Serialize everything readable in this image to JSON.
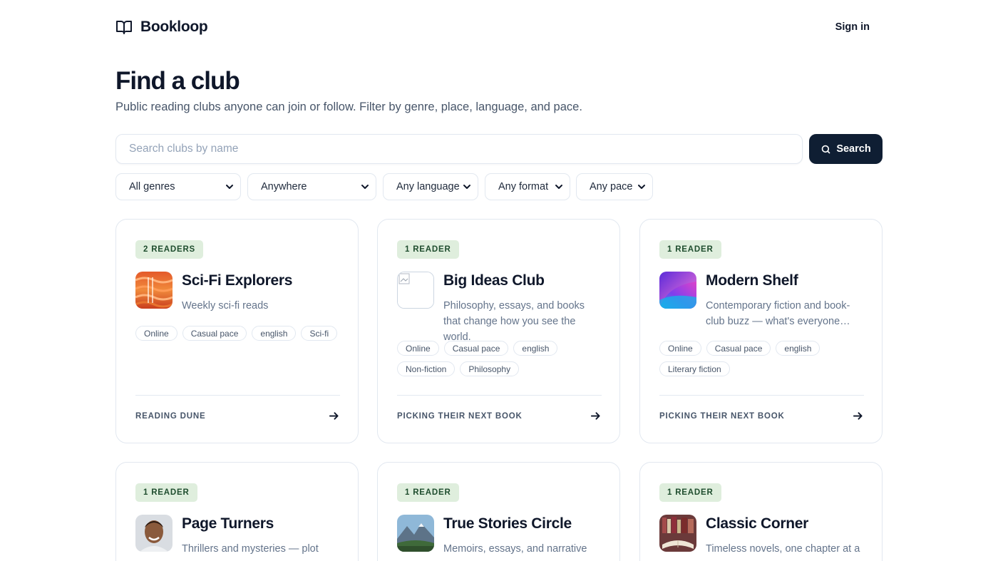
{
  "brand": {
    "name": "Bookloop",
    "icon": "open-book-icon"
  },
  "nav": {
    "sign_in": "Sign in"
  },
  "page": {
    "title": "Find a club",
    "subtitle": "Public reading clubs anyone can join or follow. Filter by genre, place, language, and pace."
  },
  "search": {
    "placeholder": "Search clubs by name",
    "value": "",
    "button_label": "Search",
    "icon": "search-icon"
  },
  "filters": [
    {
      "label": "All genres"
    },
    {
      "label": "Anywhere"
    },
    {
      "label": "Any language"
    },
    {
      "label": "Any format"
    },
    {
      "label": "Any pace"
    }
  ],
  "clubs": [
    {
      "badge": "2 READERS",
      "name": "Sci-Fi Explorers",
      "description": "Weekly sci-fi reads",
      "tags": [
        "Online",
        "Casual pace",
        "english",
        "Sci-fi"
      ],
      "status": "READING DUNE",
      "avatar": "dune-cover-image"
    },
    {
      "badge": "1 READER",
      "name": "Big Ideas Club",
      "description": "Philosophy, essays, and books that change how you see the world.",
      "tags": [
        "Online",
        "Casual pace",
        "english",
        "Non-fiction",
        "Philosophy"
      ],
      "status": "PICKING THEIR NEXT BOOK",
      "avatar": "broken-image-placeholder"
    },
    {
      "badge": "1 READER",
      "name": "Modern Shelf",
      "description": "Contemporary fiction and book-club buzz — what's everyone…",
      "tags": [
        "Online",
        "Casual pace",
        "english",
        "Literary fiction"
      ],
      "status": "PICKING THEIR NEXT BOOK",
      "avatar": "gradient-abstract-image"
    },
    {
      "badge": "1 READER",
      "name": "Page Turners",
      "description": "Thrillers and mysteries — plot",
      "tags": [],
      "status": "",
      "avatar": "person-portrait-image"
    },
    {
      "badge": "1 READER",
      "name": "True Stories Circle",
      "description": "Memoirs, essays, and narrative",
      "tags": [],
      "status": "",
      "avatar": "mountain-landscape-image"
    },
    {
      "badge": "1 READER",
      "name": "Classic Corner",
      "description": "Timeless novels, one chapter at a",
      "tags": [],
      "status": "",
      "avatar": "old-books-image"
    }
  ],
  "colors": {
    "primary": "#0f1e33",
    "badge_bg": "#dfeedd",
    "badge_text": "#1f4d2e",
    "border": "#e2e8f0"
  }
}
